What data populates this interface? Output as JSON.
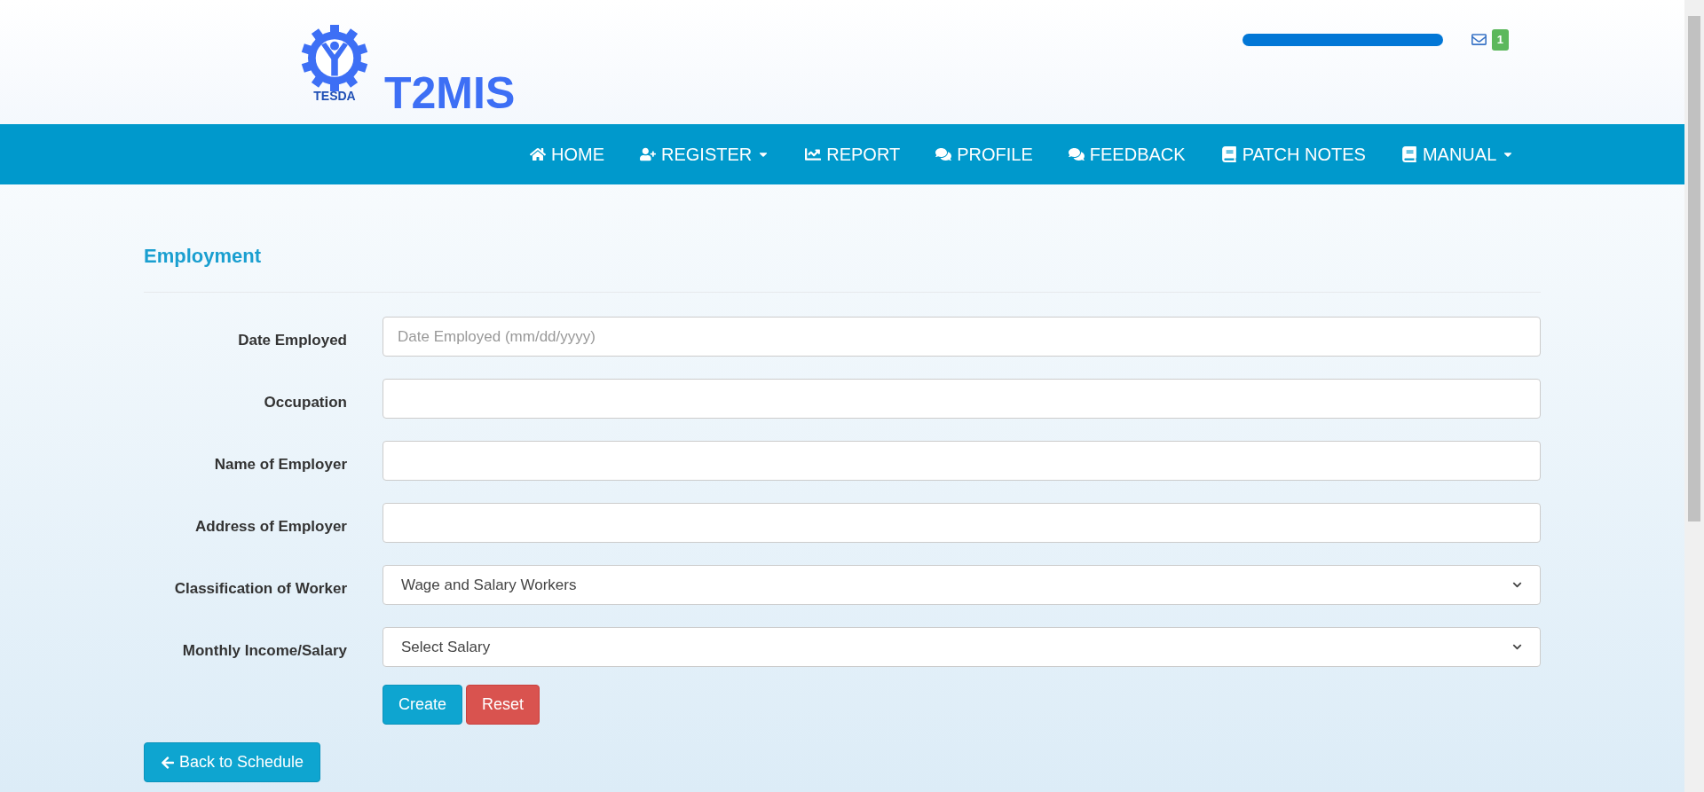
{
  "header": {
    "logo_text": "TESDA",
    "app_name": "T2MIS",
    "mail_count": "1"
  },
  "nav": [
    {
      "label": "HOME",
      "kind": "home",
      "dropdown": false
    },
    {
      "label": "REGISTER",
      "kind": "register",
      "dropdown": true
    },
    {
      "label": "REPORT",
      "kind": "report",
      "dropdown": false
    },
    {
      "label": "PROFILE",
      "kind": "chat",
      "dropdown": false
    },
    {
      "label": "FEEDBACK",
      "kind": "chat",
      "dropdown": false
    },
    {
      "label": "PATCH NOTES",
      "kind": "document",
      "dropdown": false
    },
    {
      "label": "MANUAL",
      "kind": "document",
      "dropdown": true
    }
  ],
  "form": {
    "title": "Employment",
    "fields": [
      {
        "label": "Date Employed",
        "kind": "input",
        "placeholder": "Date Employed (mm/dd/yyyy)"
      },
      {
        "label": "Occupation",
        "kind": "input"
      },
      {
        "label": "Name of Employer",
        "kind": "input"
      },
      {
        "label": "Address of Employer",
        "kind": "input"
      },
      {
        "label": "Classification of Worker",
        "kind": "select",
        "value": "Wage and Salary Workers"
      },
      {
        "label": "Monthly Income/Salary",
        "kind": "select",
        "value": "Select Salary"
      }
    ],
    "buttons": [
      {
        "label": "Create",
        "kind": "primary"
      },
      {
        "label": "Reset",
        "kind": "danger"
      }
    ],
    "back_button": "Back to Schedule"
  }
}
